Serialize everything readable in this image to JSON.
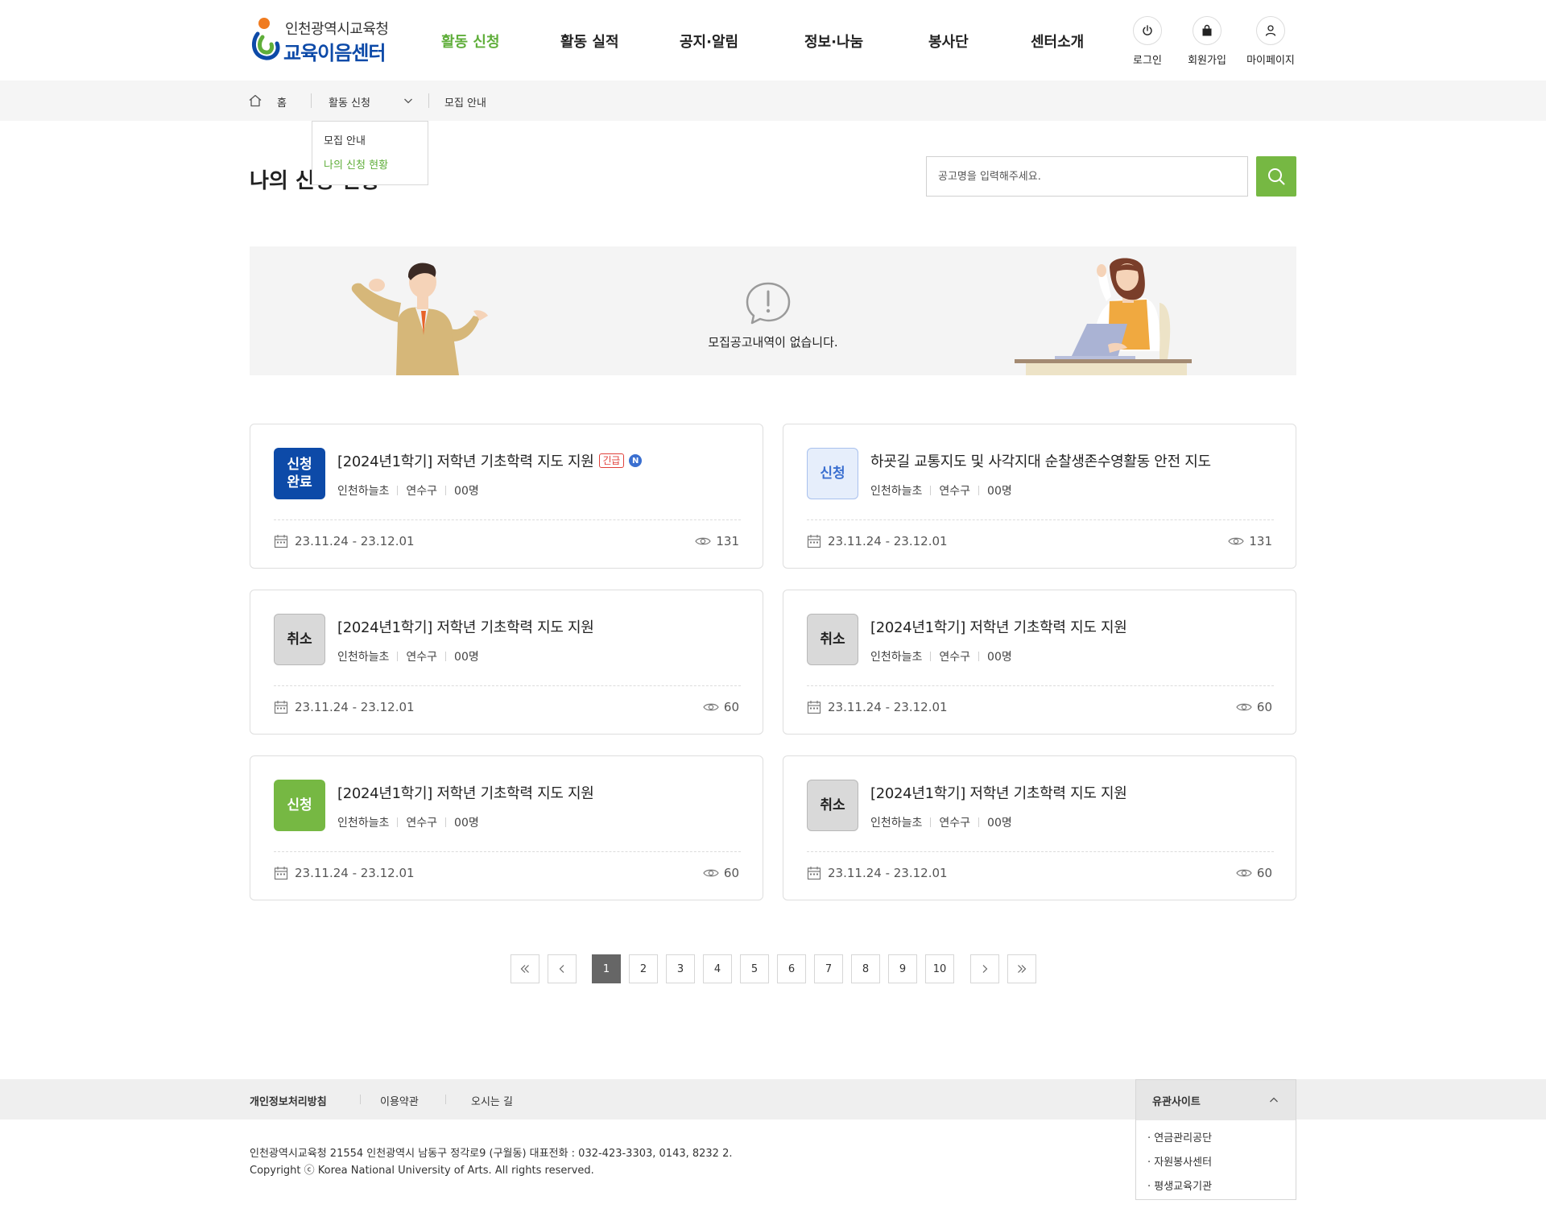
{
  "header": {
    "logo_top": "인천광역시교육청",
    "logo_bottom": "교육이음센터",
    "nav": [
      "활동 신청",
      "활동 실적",
      "공지·알림",
      "정보·나눔",
      "봉사단",
      "센터소개"
    ],
    "util": {
      "login": "로그인",
      "join": "회원가입",
      "mypage": "마이페이지"
    }
  },
  "location": {
    "home": "홈",
    "depth1": "활동 신청",
    "depth2": "모집 안내",
    "dropdown": [
      "모집 안내",
      "나의 신청 현황"
    ]
  },
  "page": {
    "title": "나의 신청 현황",
    "search_placeholder": "공고명을 입력해주세요."
  },
  "empty": {
    "message": "모집공고내역이 없습니다."
  },
  "cards": [
    {
      "badge": "신청\n완료",
      "badge_type": "done",
      "title": "[2024년1학기] 저학년 기초학력 지도 지원",
      "urgent": "긴급",
      "new": "N",
      "school": "인천하늘초",
      "district": "연수구",
      "count": "00명",
      "date": "23.11.24 - 23.12.01",
      "views": "131"
    },
    {
      "badge": "신청",
      "badge_type": "apply-light",
      "title": "하굣길 교통지도 및 사각지대 순찰생존수영활동 안전 지도",
      "school": "인천하늘초",
      "district": "연수구",
      "count": "00명",
      "date": "23.11.24 - 23.12.01",
      "views": "131"
    },
    {
      "badge": "취소",
      "badge_type": "cancel",
      "title": "[2024년1학기] 저학년 기초학력 지도 지원",
      "school": "인천하늘초",
      "district": "연수구",
      "count": "00명",
      "date": "23.11.24 - 23.12.01",
      "views": "60"
    },
    {
      "badge": "취소",
      "badge_type": "cancel",
      "title": "[2024년1학기] 저학년 기초학력 지도 지원",
      "school": "인천하늘초",
      "district": "연수구",
      "count": "00명",
      "date": "23.11.24 - 23.12.01",
      "views": "60"
    },
    {
      "badge": "신청",
      "badge_type": "apply",
      "title": "[2024년1학기] 저학년 기초학력 지도 지원",
      "school": "인천하늘초",
      "district": "연수구",
      "count": "00명",
      "date": "23.11.24 - 23.12.01",
      "views": "60"
    },
    {
      "badge": "취소",
      "badge_type": "cancel",
      "title": "[2024년1학기] 저학년 기초학력 지도 지원",
      "school": "인천하늘초",
      "district": "연수구",
      "count": "00명",
      "date": "23.11.24 - 23.12.01",
      "views": "60"
    }
  ],
  "pagination": {
    "pages": [
      "1",
      "2",
      "3",
      "4",
      "5",
      "6",
      "7",
      "8",
      "9",
      "10"
    ],
    "current": "1"
  },
  "footer": {
    "links": [
      "개인정보처리방침",
      "이용약관",
      "오시는 길"
    ],
    "family_title": "유관사이트",
    "family_sites": [
      "· 연금관리공단",
      "· 자원봉사센터",
      "· 평생교육기관"
    ],
    "address": "인천광역시교육청 21554 인천광역시 남동구 정각로9 (구월동) 대표전화 : 032-423-3303, 0143, 8232 2.",
    "copyright": "Copyright ⓒ Korea National University of Arts. All rights reserved."
  },
  "colors": {
    "accent_green": "#76b843",
    "brand_blue": "#0d4aa8",
    "urgent_red": "#e0413b"
  }
}
